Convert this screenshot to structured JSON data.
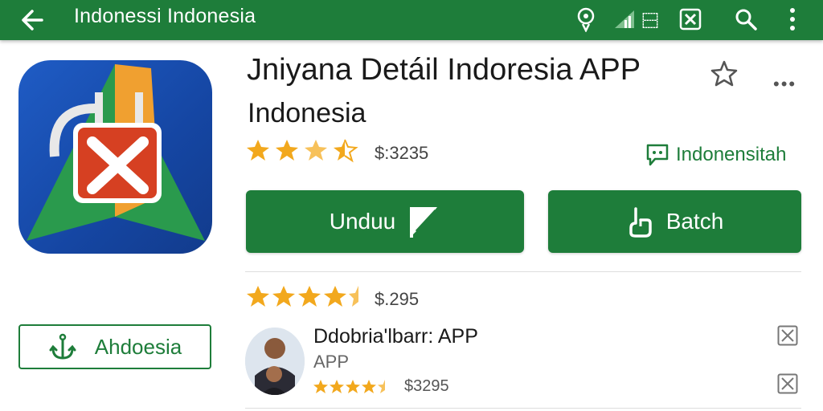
{
  "topbar": {
    "title": "Indonessi Indonesia",
    "icons": [
      "back-arrow-icon",
      "location-pin-icon",
      "signal-icon",
      "translate-icon",
      "tools-icon",
      "search-icon",
      "more-vert-icon"
    ]
  },
  "app": {
    "name": "Jniyana Detáil Indoresia APP",
    "subtitle": "Indonesia",
    "rating": 3.5,
    "price": "$:3235",
    "chat_label": "Indonensitah"
  },
  "buttons": {
    "primary": "Unduu",
    "secondary": "Batch",
    "outline": "Ahdoesia"
  },
  "rating2": {
    "rating": 4.5,
    "price": "$.295"
  },
  "list_item": {
    "title": "Ddobria'lbarr: APP",
    "subtitle": "APP",
    "rating": 4.5,
    "price": "$3295"
  },
  "colors": {
    "primary_green": "#1e7d3a",
    "star_gold": "#f2a81d",
    "icon_blue": "#1f5cc5"
  }
}
